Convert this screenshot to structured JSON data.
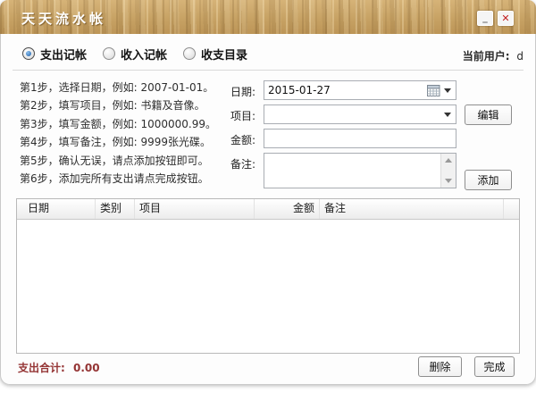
{
  "window": {
    "title": "天天流水帐"
  },
  "titlebar_icons": {
    "minimize": "_",
    "close": "✕"
  },
  "topbar": {
    "radios": [
      {
        "label": "支出记帐",
        "selected": true
      },
      {
        "label": "收入记帐",
        "selected": false
      },
      {
        "label": "收支目录",
        "selected": false
      }
    ],
    "current_user_label": "当前用户:",
    "current_user_value": "d"
  },
  "instructions": [
    "第1步，选择日期，例如: 2007-01-01。",
    "第2步，填写项目，例如: 书籍及音像。",
    "第3步，填写金额，例如: 1000000.99。",
    "第4步，填写备注，例如: 9999张光碟。",
    "第5步，确认无误，请点添加按钮即可。",
    "第6步，添加完所有支出请点完成按钮。"
  ],
  "form": {
    "date_label": "日期:",
    "date_value": "2015-01-27",
    "project_label": "项目:",
    "project_value": "",
    "edit_button": "编辑",
    "amount_label": "金额:",
    "amount_value": "",
    "notes_label": "备注:",
    "notes_value": "",
    "add_button": "添加"
  },
  "table": {
    "headers": [
      "日期",
      "类别",
      "项目",
      "金额",
      "备注"
    ],
    "rows": []
  },
  "footer": {
    "total_label": "支出合计:",
    "total_value": "0.00",
    "delete_button": "删除",
    "done_button": "完成"
  },
  "colors": {
    "wood": "#c7a264",
    "title_text": "#ffffff",
    "total_text": "#943434",
    "radio_selected": "#1e5fa8",
    "close_x": "#c21f1f"
  }
}
